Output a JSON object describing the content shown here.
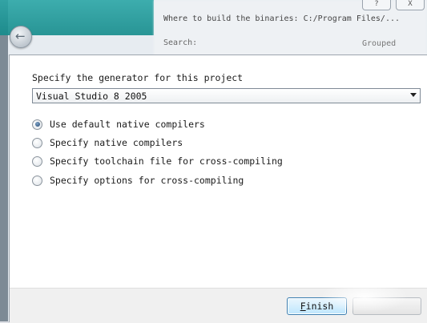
{
  "background_window": {
    "where_label": "Where to build the binaries:  C:/Program Files/...",
    "search_label": "Search:",
    "grouped_label": "Grouped",
    "top_buttons": [
      "?",
      "X"
    ]
  },
  "dialog": {
    "generator_prompt": "Specify the generator for this project",
    "generator_selected": "Visual Studio 8 2005",
    "options": [
      {
        "label": "Use default native compilers",
        "selected": true
      },
      {
        "label": "Specify native compilers",
        "selected": false
      },
      {
        "label": "Specify toolchain file for cross-compiling",
        "selected": false
      },
      {
        "label": "Specify options for cross-compiling",
        "selected": false
      }
    ],
    "finish_first": "F",
    "finish_rest": "inish"
  },
  "colors": {
    "accent_teal": "#1a9999",
    "button_focus": "#3c7fb1"
  }
}
